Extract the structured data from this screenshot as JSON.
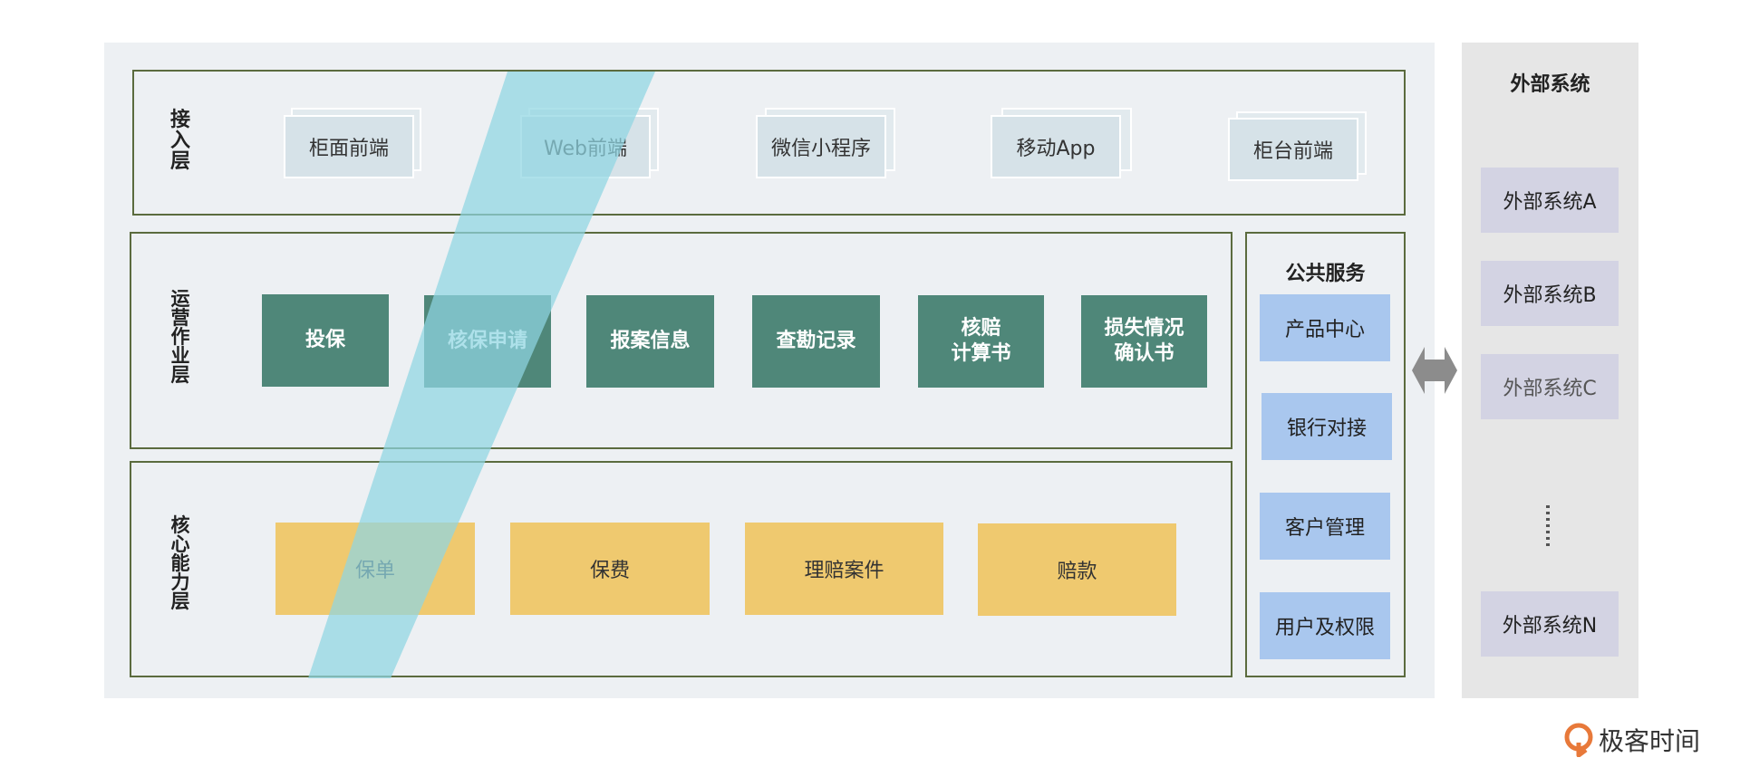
{
  "layers": {
    "access": "接入层",
    "ops": "运营作业层",
    "core": "核心能力层"
  },
  "access_items": [
    "柜面前端",
    "Web前端",
    "微信小程序",
    "移动App",
    "柜台前端"
  ],
  "ops_items": [
    [
      "投保"
    ],
    [
      "核保申请"
    ],
    [
      "报案信息"
    ],
    [
      "查勘记录"
    ],
    [
      "核赔",
      "计算书"
    ],
    [
      "损失情况",
      "确认书"
    ]
  ],
  "core_items": [
    "保单",
    "保费",
    "理赔案件",
    "赔款"
  ],
  "public_services": {
    "title": "公共服务",
    "items": [
      "产品中心",
      "银行对接",
      "客户管理",
      "用户及权限"
    ]
  },
  "external": {
    "title": "外部系统",
    "items": [
      "外部系统A",
      "外部系统B",
      "外部系统C",
      "外部系统N"
    ]
  },
  "brand": "极客时间",
  "colors": {
    "access_box": "#d6e2e8",
    "ops_box": "#4f8779",
    "core_box": "#efc96f",
    "service_box": "#a9c7ee",
    "external_box": "#d3d3e3",
    "highlight_band": "#8fd6e2",
    "frame_border": "#5b6b3e"
  }
}
